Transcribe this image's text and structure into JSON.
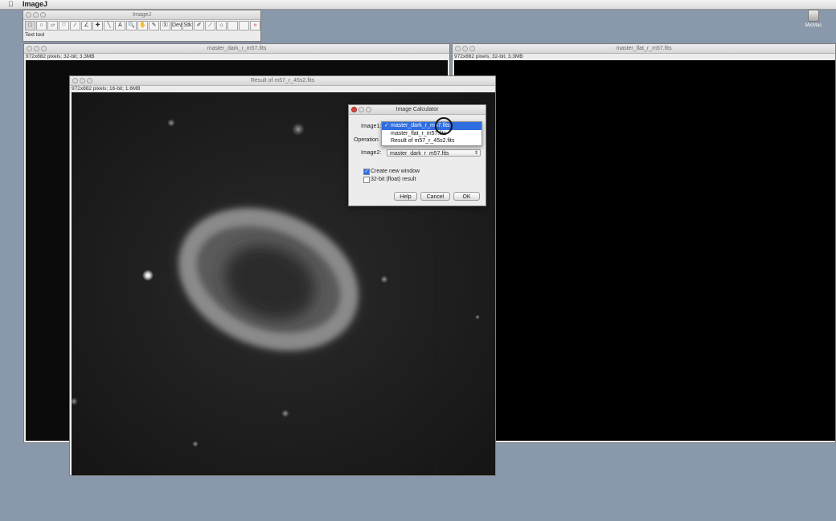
{
  "menubar": {
    "apple": "",
    "app_name": "ImageJ"
  },
  "desktop": {
    "disk_label": "MicMac"
  },
  "imagej": {
    "title": "ImageJ",
    "status": "Text tool",
    "tools": [
      "□",
      "○",
      "▱",
      "♡",
      "∕",
      "∠",
      "✚",
      "╲",
      "A",
      "🔍",
      "✋",
      "✎",
      "Ⓧ",
      "Dev",
      "Stk",
      "✐",
      "⟋",
      "⌂",
      "",
      "",
      " »"
    ]
  },
  "dark_window": {
    "title": "master_dark_r_m57.fits",
    "info": "972x882 pixels; 32-bit; 3.3MB"
  },
  "flat_window": {
    "title": "master_flat_r_m57.fits",
    "info": "972x882 pixels; 32-bit; 3.3MB"
  },
  "result_window": {
    "title": "Result of m57_r_45s2.fits",
    "info": "972x882 pixels; 16-bit; 1.6MB"
  },
  "dialog": {
    "title": "Image Calculator",
    "image1_label": "Image1:",
    "operation_label": "Operation",
    "image2_label": "Image2:",
    "image2_value": "master_dark_r_m57.fits",
    "dropdown_options": [
      {
        "label": "master_dark_r_m57.fits",
        "selected": true
      },
      {
        "label": "master_flat_r_m57.fits",
        "selected": false
      },
      {
        "label": "Result of m57_r_45s2.fits",
        "selected": false
      }
    ],
    "create_new_window": "Create new window",
    "create_new_window_checked": true,
    "float_result": "32-bit (float) result",
    "float_result_checked": false,
    "help": "Help",
    "cancel": "Cancel",
    "ok": "OK"
  },
  "colors": {
    "desktop": "#8a98ab",
    "selection": "#2f6de0"
  }
}
